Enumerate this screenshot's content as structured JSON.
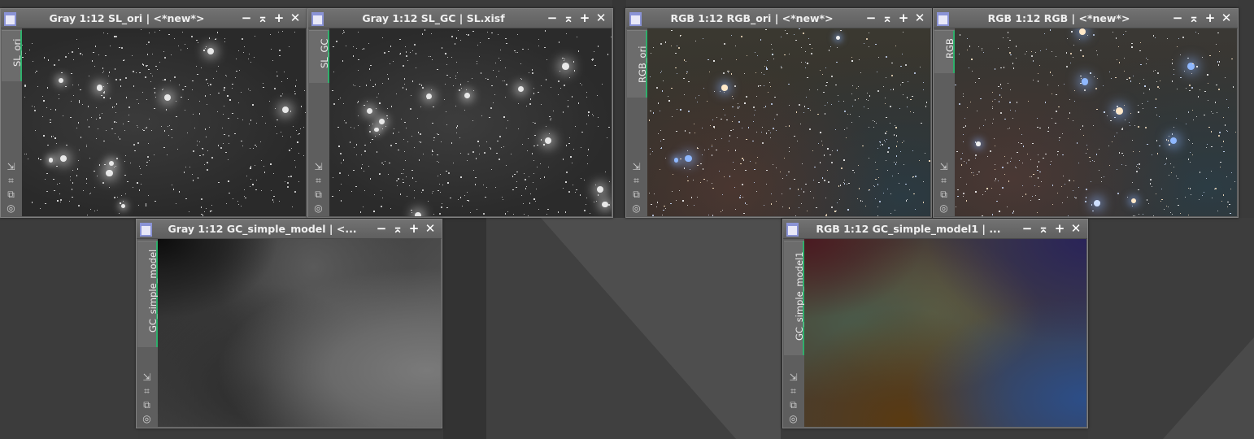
{
  "windows": {
    "sl_ori": {
      "title": "Gray 1:12 SL_ori | <*new*>",
      "tab_label": "SL_ori",
      "mode": "gray"
    },
    "sl_gc": {
      "title": "Gray 1:12 SL_GC | SL.xisf",
      "tab_label": "SL_GC",
      "mode": "gray"
    },
    "rgb_ori": {
      "title": "RGB 1:12 RGB_ori | <*new*>",
      "tab_label": "RGB_ori",
      "mode": "rgb"
    },
    "rgb": {
      "title": "RGB 1:12 RGB | <*new*>",
      "tab_label": "RGB",
      "mode": "rgb"
    },
    "gc_simple_model": {
      "title": "Gray 1:12 GC_simple_model | <...",
      "tab_label": "GC_simple_model",
      "mode": "gray-model"
    },
    "gc_simple_model1": {
      "title": "RGB 1:12 GC_simple_model1 | ...",
      "tab_label": "GC_simple_model1",
      "mode": "rgb-model"
    }
  },
  "window_buttons": {
    "shade": "−",
    "maximize": "⌅",
    "restore": "+",
    "close": "✕"
  },
  "side_icons": {
    "fit": "⇲",
    "zoom": "⌗",
    "clone": "⧉",
    "identity": "◎"
  },
  "colors": {
    "tab_accent": "#2fae6b",
    "window_icon": "#8a93d6",
    "workspace": "#3b3b3b"
  }
}
